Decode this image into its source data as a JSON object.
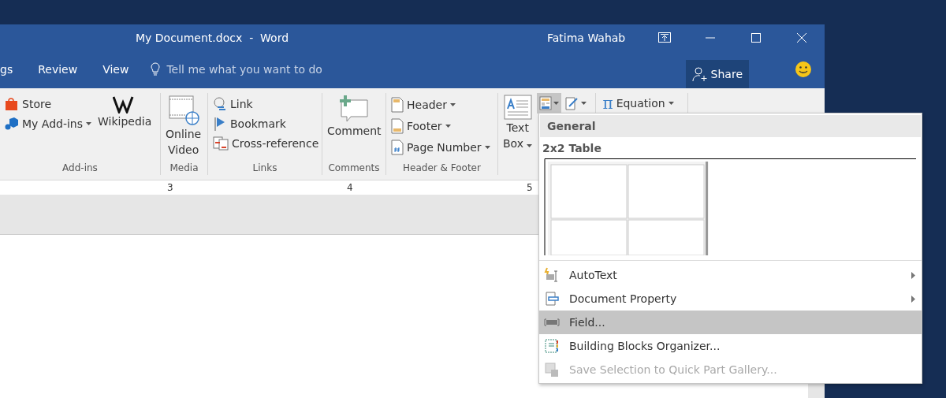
{
  "window": {
    "title": "My Document.docx  -  Word",
    "user": "Fatima Wahab"
  },
  "tabs": [
    {
      "label": "gs",
      "selected": false
    },
    {
      "label": "Review",
      "selected": false
    },
    {
      "label": "View",
      "selected": false
    }
  ],
  "tell_me": {
    "placeholder": "Tell me what you want to do"
  },
  "share_button": "Share",
  "ribbon": {
    "groups": [
      {
        "label": "Add-ins",
        "kind": "addins",
        "small": [
          {
            "label": "Store",
            "dropdown": false
          },
          {
            "label": "My Add-ins",
            "dropdown": true
          }
        ],
        "large": [
          {
            "label": "Wikipedia",
            "dropdown": false
          }
        ]
      },
      {
        "label": "Media",
        "kind": "large",
        "large": [
          {
            "label": "Online Video",
            "dropdown": false
          }
        ]
      },
      {
        "label": "Links",
        "kind": "small",
        "small": [
          {
            "label": "Link",
            "dropdown": false
          },
          {
            "label": "Bookmark",
            "dropdown": false
          },
          {
            "label": "Cross-reference",
            "dropdown": false
          }
        ]
      },
      {
        "label": "Comments",
        "kind": "large",
        "large": [
          {
            "label": "Comment",
            "dropdown": false
          }
        ]
      },
      {
        "label": "Header & Footer",
        "kind": "small",
        "small": [
          {
            "label": "Header",
            "dropdown": true
          },
          {
            "label": "Footer",
            "dropdown": true
          },
          {
            "label": "Page Number",
            "dropdown": true
          }
        ]
      },
      {
        "kind": "text",
        "large": [
          {
            "label": "Text Box",
            "dropdown": true
          }
        ],
        "tools": [
          {
            "pressed": true
          },
          {
            "pressed": false
          }
        ],
        "equation": {
          "symbol": "π",
          "label": "Equation"
        }
      }
    ]
  },
  "ruler": [
    "3",
    "4",
    "5"
  ],
  "quick_parts_menu": {
    "header": "General",
    "section": "2x2 Table",
    "items": [
      {
        "label": "AutoText",
        "submenu": true,
        "selected": false,
        "disabled": false
      },
      {
        "label": "Document Property",
        "submenu": true,
        "selected": false,
        "disabled": false
      },
      {
        "label": "Field...",
        "submenu": false,
        "selected": true,
        "disabled": false
      },
      {
        "label": "Building Blocks Organizer...",
        "submenu": false,
        "selected": false,
        "disabled": false
      },
      {
        "label": "Save Selection to Quick Part Gallery...",
        "submenu": false,
        "selected": false,
        "disabled": true
      }
    ]
  }
}
